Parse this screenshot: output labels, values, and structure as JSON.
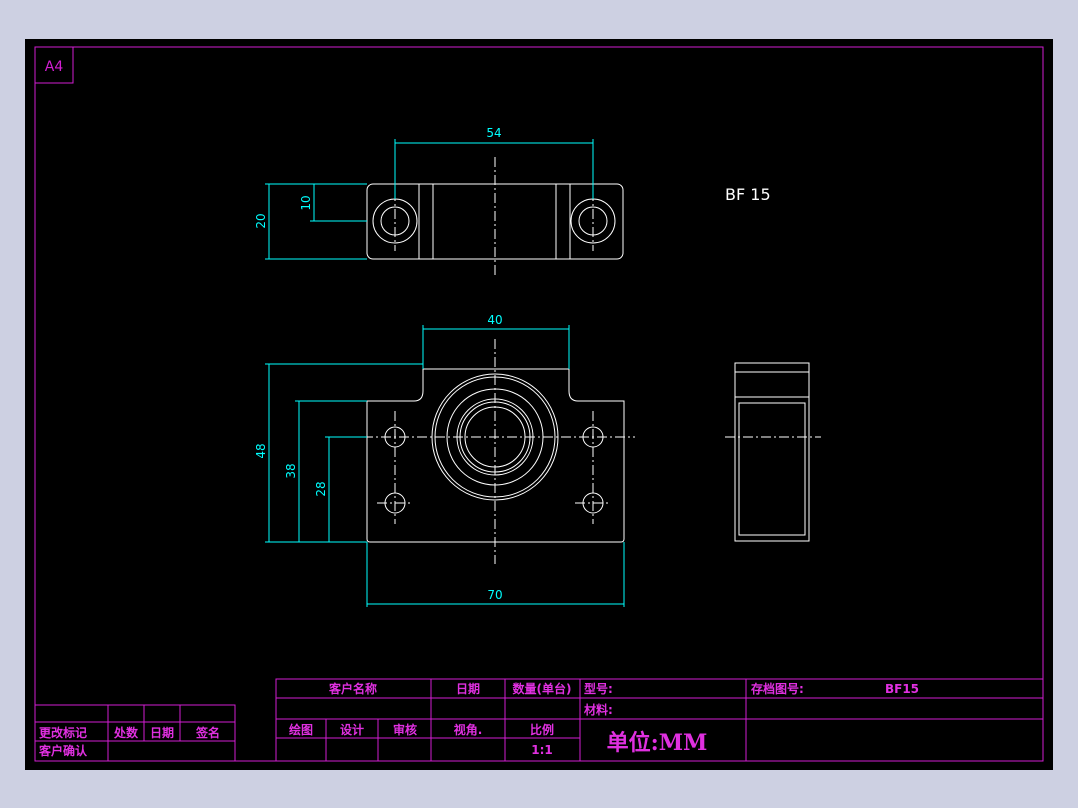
{
  "sheet": {
    "size_label": "A4",
    "colors": {
      "background": "#cdd0e2",
      "canvas": "#000000",
      "frame": "#d21ed2",
      "geometry": "#ffffff",
      "dimension": "#00ffff"
    }
  },
  "drawing": {
    "part_label": "BF 15",
    "dimensions": {
      "top_width": "54",
      "top_height": "20",
      "top_hole_offset": "10",
      "front_step_width": "40",
      "front_height": "48",
      "front_hole_upper": "38",
      "front_center": "28",
      "front_width": "70"
    }
  },
  "title_block": {
    "customer_name": "客户名称",
    "date": "日期",
    "quantity": "数量(单台)",
    "model": "型号:",
    "archive_no": "存档图号:",
    "archive_value": "BF15",
    "material": "材料:",
    "drawn": "绘图",
    "design": "设计",
    "review": "审核",
    "view_angle": "视角.",
    "scale_label": "比例",
    "scale_value": "1:1",
    "unit": "单位:MM"
  },
  "revision_block": {
    "change_mark": "更改标记",
    "count": "处数",
    "date": "日期",
    "signature": "签名",
    "customer_confirm": "客户确认"
  }
}
